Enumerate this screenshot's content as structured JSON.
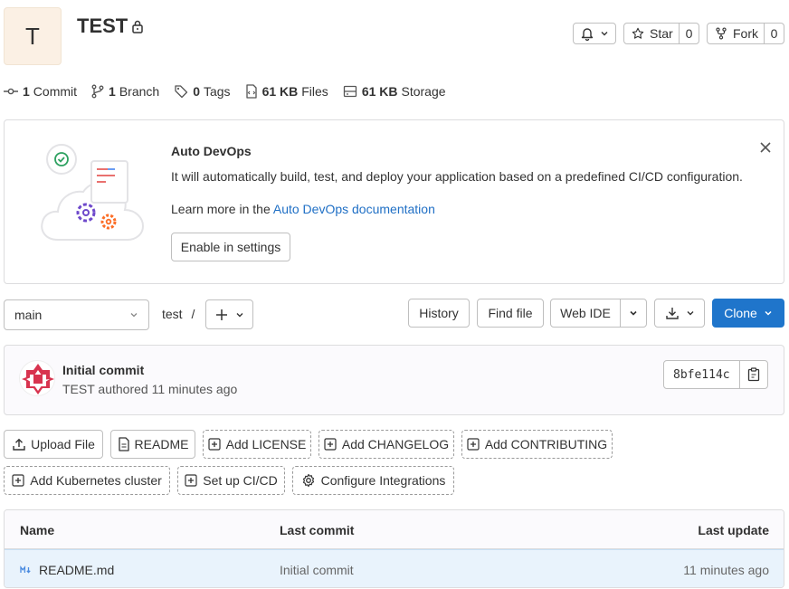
{
  "project": {
    "avatar_letter": "T",
    "name": "TEST"
  },
  "header_actions": {
    "star_label": "Star",
    "star_count": "0",
    "fork_label": "Fork",
    "fork_count": "0"
  },
  "stats": [
    {
      "icon": "commit-icon",
      "value": "1",
      "label": "Commit"
    },
    {
      "icon": "branch-icon",
      "value": "1",
      "label": "Branch"
    },
    {
      "icon": "tag-icon",
      "value": "0",
      "label": "Tags"
    },
    {
      "icon": "file-icon",
      "value": "61 KB",
      "label": "Files"
    },
    {
      "icon": "storage-icon",
      "value": "61 KB",
      "label": "Storage"
    }
  ],
  "auto_devops": {
    "title": "Auto DevOps",
    "description": "It will automatically build, test, and deploy your application based on a predefined CI/CD configuration.",
    "learn_prefix": "Learn more in the ",
    "learn_link": "Auto DevOps documentation",
    "enable_button": "Enable in settings"
  },
  "toolbar": {
    "branch": "main",
    "path": "test",
    "path_separator": "/",
    "history": "History",
    "find_file": "Find file",
    "web_ide": "Web IDE",
    "clone": "Clone"
  },
  "last_commit": {
    "title": "Initial commit",
    "author": "TEST",
    "meta": "authored 11 minutes ago",
    "sha": "8bfe114c"
  },
  "quick_actions": [
    {
      "label": "Upload File",
      "icon": "upload-icon",
      "style": "solid"
    },
    {
      "label": "README",
      "icon": "document-icon",
      "style": "solid"
    },
    {
      "label": "Add LICENSE",
      "icon": "plus-square-icon",
      "style": "dashed"
    },
    {
      "label": "Add CHANGELOG",
      "icon": "plus-square-icon",
      "style": "dashed"
    },
    {
      "label": "Add CONTRIBUTING",
      "icon": "plus-square-icon",
      "style": "dashed"
    },
    {
      "label": "Add Kubernetes cluster",
      "icon": "plus-square-icon",
      "style": "dashed"
    },
    {
      "label": "Set up CI/CD",
      "icon": "plus-square-icon",
      "style": "dashed"
    },
    {
      "label": "Configure Integrations",
      "icon": "gear-icon",
      "style": "dashed"
    }
  ],
  "file_table": {
    "columns": [
      "Name",
      "Last commit",
      "Last update"
    ],
    "rows": [
      {
        "name": "README.md",
        "last_commit": "Initial commit",
        "last_update": "11 minutes ago"
      }
    ]
  },
  "colors": {
    "primary": "#1f75cb",
    "link": "#1f6fc5",
    "row_highlight": "#e9f3fc"
  }
}
